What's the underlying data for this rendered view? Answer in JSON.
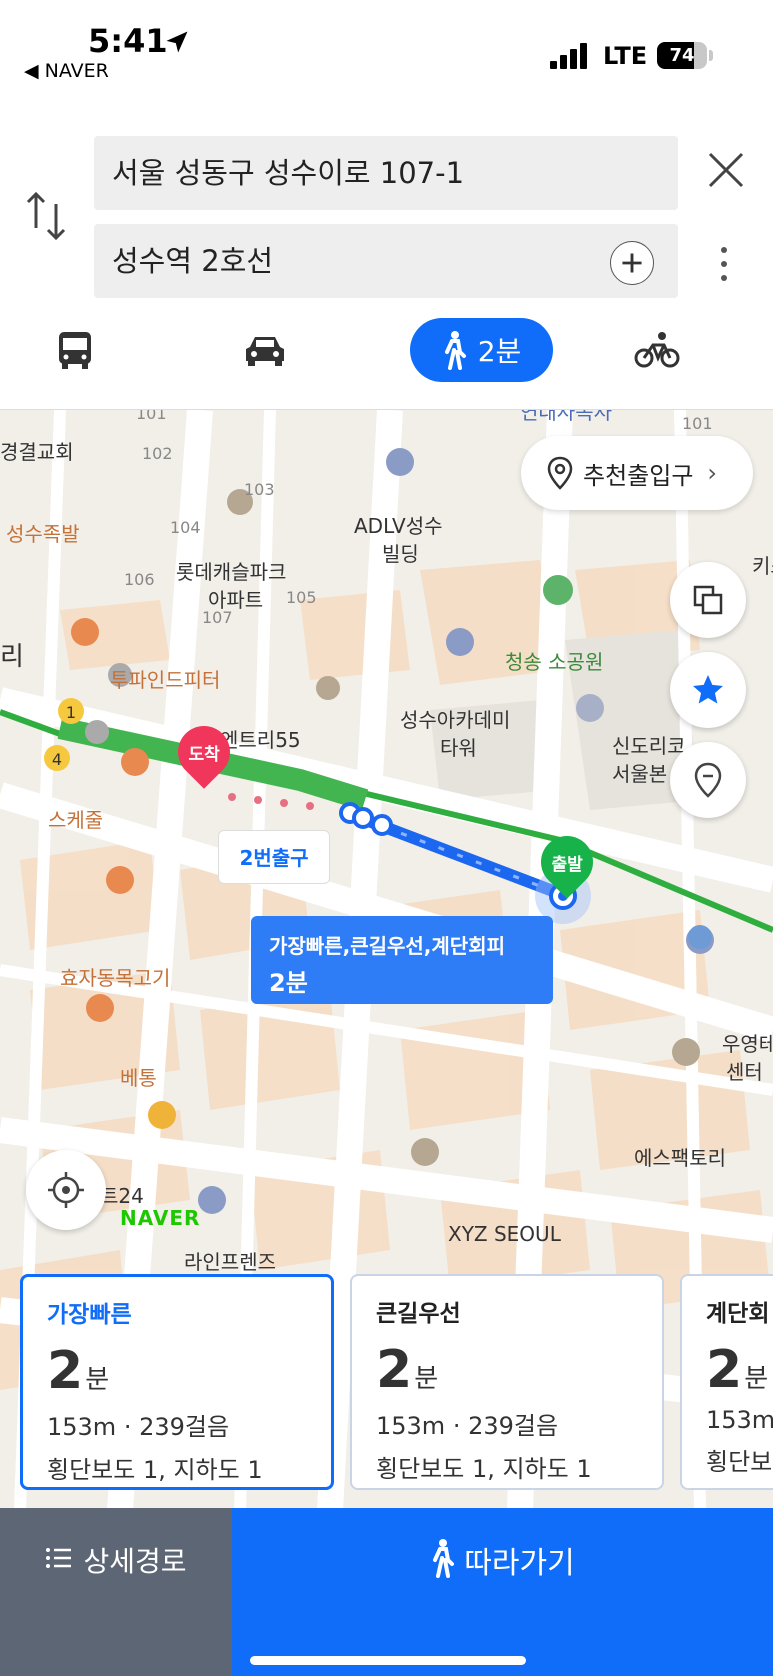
{
  "status_bar": {
    "time": "5:41",
    "back_app": "NAVER",
    "network": "LTE",
    "battery": "74",
    "battery_level": 0.74
  },
  "search": {
    "origin": "서울 성동구 성수이로 107-1",
    "destination": "성수역 2호선"
  },
  "modes": {
    "walk_label": "2분",
    "selected": "walk"
  },
  "map": {
    "labels": {
      "church": "경결교회",
      "seongsujokbal": "성수족발",
      "lotte": "롯데캐슬파크",
      "apt": "아파트",
      "adlv": "ADLV성수",
      "adlv2": "빌딩",
      "park": "청송 소공원",
      "twopint": "투파인드피터",
      "academy": "성수아카데미",
      "tower": "타워",
      "shindo": "신도리코",
      "seoulbon": "서울본",
      "entry55": "엔트리55",
      "skejul": "스케줄",
      "hyoja": "효자동목고기",
      "betong": "베통",
      "u24": "트24",
      "lineFriends": "라인프렌즈",
      "xyz": "XYZ SEOUL",
      "espac": "에스팩토리",
      "wooyoung": "우영테",
      "center": "센터",
      "yondae": "연대사옥사",
      "kisung": "키스",
      "ri": "리",
      "n101a": "101",
      "n101b": "101",
      "n102": "102",
      "n103": "103",
      "n104": "104",
      "n105": "105",
      "n106": "106",
      "n107": "107"
    },
    "exit_button": "추천출입구",
    "exit_tag": "2번출구",
    "arrive_label": "도착",
    "depart_label": "출발",
    "bubble_line1": "가장빠른,큰길우선,계단회피",
    "bubble_line2": "2분",
    "naver_logo": "NAVER",
    "station_numbers": [
      "1",
      "4"
    ]
  },
  "cards": [
    {
      "name": "가장빠른",
      "duration": "2",
      "unit": "분",
      "distance": "153m · 239걸음",
      "crossings": "횡단보도 1, 지하도 1"
    },
    {
      "name": "큰길우선",
      "duration": "2",
      "unit": "분",
      "distance": "153m · 239걸음",
      "crossings": "횡단보도 1, 지하도 1"
    },
    {
      "name": "계단회",
      "duration": "2",
      "unit": "분",
      "distance": "153m",
      "crossings": "횡단보"
    }
  ],
  "bottom": {
    "detail": "상세경로",
    "follow": "따라가기"
  },
  "colors": {
    "accent": "#0f6dfa",
    "route_green": "#3cb44a",
    "arrive": "#f0365b",
    "depart": "#17b34a"
  }
}
